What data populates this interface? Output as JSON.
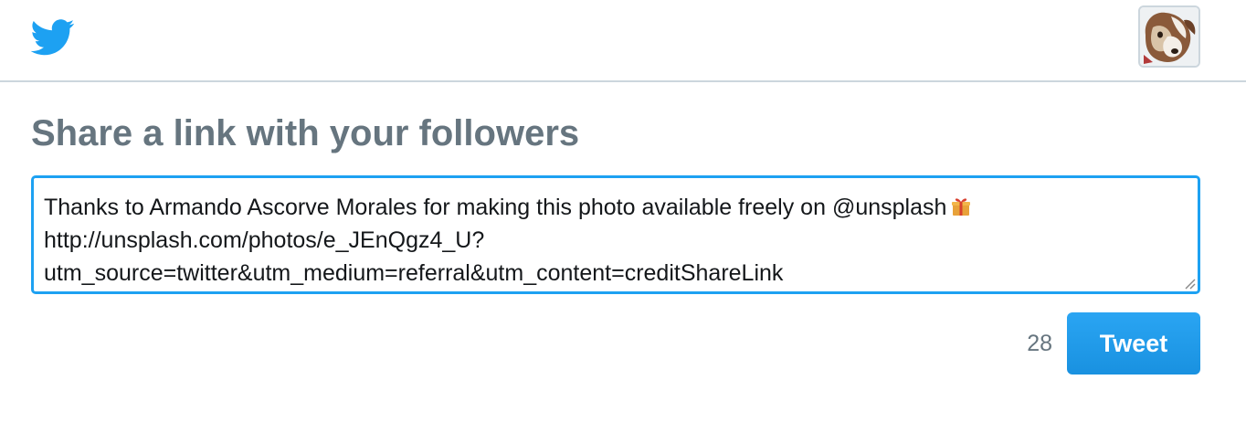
{
  "header": {
    "logo_icon": "twitter-bird-icon",
    "avatar_icon": "user-avatar-dog"
  },
  "heading": "Share a link with your followers",
  "compose": {
    "line1": "Thanks to Armando Ascorve Morales for making this photo available freely on @unsplash",
    "gift_icon": "gift-emoji-icon",
    "line2": "http://unsplash.com/photos/e_JEnQgz4_U?",
    "line3": "utm_source=twitter&utm_medium=referral&utm_content=creditShareLink"
  },
  "counter": "28",
  "tweet_label": "Tweet",
  "colors": {
    "accent": "#1da1f2",
    "heading": "#66757f",
    "border": "#ccd6dd"
  }
}
